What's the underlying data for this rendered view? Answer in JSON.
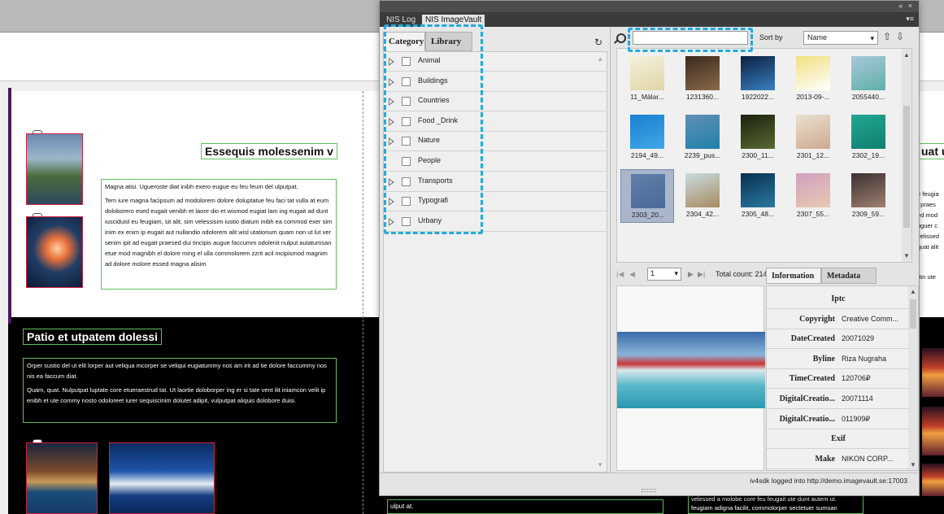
{
  "document": {
    "heading1": "Essequis molessenim v",
    "heading2": "Patio et utpatem dolessi",
    "partial_heading": "uat u",
    "para1": "Magna atisi. Ugueroste diat inibh exero eugue eu feu feum del ulputpat.",
    "para2": "Tem iure magna facipsum ad modolorem dolore doluptatue feu faci tat vulla at eum doloborero esed eugait venibh et laore dio et wismod eugiat lam ing eugait ad dunt iusciduisl eu feugiam, sit alit, sim velessisim iustio diatum inibh ea commod exer sim inim ex enim ip eugait aut nullandio odolorem alit wisl utationum quam non ut lut ver senim ipit ad eugait praesed dui tincipis augue faccumm odolenit nulput autatumsan etue mod magnibh el dolore ming el ulla commolorem zzrit acil incipismod magnim ad dolore molore essed magna alisim",
    "para3": "Orper sustio del ut elit lorper aut veliqua mcorper se veliqui eugiatummy nos am irit ad tie dolore faccummy nos nis ea faccum diat.",
    "para4": "Quam, quat. Nulputpat luptate core etueraestrud tat. Ut laortie doloborper ing er si tate vent ilit iniamcon velit ip enibh et ute commy nosto odoloreet iurer sequiscinim dolutet adipit, vulputpat aliquis dolobore duisi.",
    "right_snippet": "e feugia\nt praes\ned mod\nuguer c\nvelissed\nquat alit",
    "right_snippet2": "rtin ute",
    "bottom_text1": "ulput at.",
    "bottom_text2": "velessed a molobe core feu feugait ute dunt autem ut.",
    "bottom_text3": "feugiam adigna facilit, commolorper sectetuer sumsan"
  },
  "panel": {
    "controls": "«  ×",
    "menu_icon": "▾≡",
    "tabs": [
      "NIS Log",
      "NIS ImageVault"
    ],
    "category_tabs": [
      "Category",
      "Library"
    ],
    "refresh_icon": "↻",
    "categories": [
      {
        "label": "Animal",
        "expandable": true
      },
      {
        "label": "Buildings",
        "expandable": true
      },
      {
        "label": "Countries",
        "expandable": true
      },
      {
        "label": "Food _Drink",
        "expandable": true
      },
      {
        "label": "Nature",
        "expandable": true
      },
      {
        "label": "People",
        "expandable": false
      },
      {
        "label": "Transports",
        "expandable": true
      },
      {
        "label": "Typografi",
        "expandable": true
      },
      {
        "label": "Urbany",
        "expandable": true
      }
    ],
    "search": {
      "value": "",
      "placeholder": ""
    },
    "sort_label": "Sort by",
    "sort_value": "Name",
    "thumbnails": [
      {
        "label": "11_Mälar...",
        "colors": [
          "#f4f0dc",
          "#e0d6a8"
        ]
      },
      {
        "label": "1231360...",
        "colors": [
          "#3a2a1e",
          "#8a6a4a"
        ]
      },
      {
        "label": "1922022...",
        "colors": [
          "#0a2040",
          "#3a80c0"
        ]
      },
      {
        "label": "2013-09-...",
        "colors": [
          "#f0e080",
          "#ffffff"
        ]
      },
      {
        "label": "2055440...",
        "colors": [
          "#a8c8d8",
          "#60b0a8"
        ]
      },
      {
        "label": "2194_49...",
        "colors": [
          "#1a80d0",
          "#40a8e8"
        ]
      },
      {
        "label": "2239_pus...",
        "colors": [
          "#6090b8",
          "#2080a8"
        ]
      },
      {
        "label": "2300_11...",
        "colors": [
          "#1a2010",
          "#5a6a30"
        ]
      },
      {
        "label": "2301_12...",
        "colors": [
          "#e8e0d0",
          "#d0a890"
        ]
      },
      {
        "label": "2302_19...",
        "colors": [
          "#20a890",
          "#108070"
        ]
      },
      {
        "label": "2303_20...",
        "colors": [
          "#6080a8",
          "#4a6a98"
        ],
        "selected": true
      },
      {
        "label": "2304_42...",
        "colors": [
          "#c8dce0",
          "#a88a60"
        ]
      },
      {
        "label": "2305_48...",
        "colors": [
          "#0a3050",
          "#2a78a0"
        ]
      },
      {
        "label": "2307_55...",
        "colors": [
          "#d0a0c0",
          "#e8c8b0"
        ]
      },
      {
        "label": "2309_59...",
        "colors": [
          "#3a3030",
          "#a08070"
        ]
      }
    ],
    "page_number": "1",
    "total_count": "Total count: 214",
    "info_tabs": [
      "Information",
      "Metadata"
    ],
    "metadata": {
      "section1": "Iptc",
      "rows1": [
        {
          "key": "Copyright",
          "value": "Creative Comm..."
        },
        {
          "key": "DateCreated",
          "value": "20071029"
        },
        {
          "key": "Byline",
          "value": "Riza Nugraha"
        },
        {
          "key": "TimeCreated",
          "value": "120706₽"
        },
        {
          "key": "DigitalCreatio...",
          "value": "20071114"
        },
        {
          "key": "DigitalCreatio...",
          "value": "011909₽"
        }
      ],
      "section2": "Exif",
      "rows2": [
        {
          "key": "Make",
          "value": "NIKON CORP..."
        }
      ]
    },
    "status": "iv4sdk logged into http://demo.imagevault.se:17003"
  }
}
